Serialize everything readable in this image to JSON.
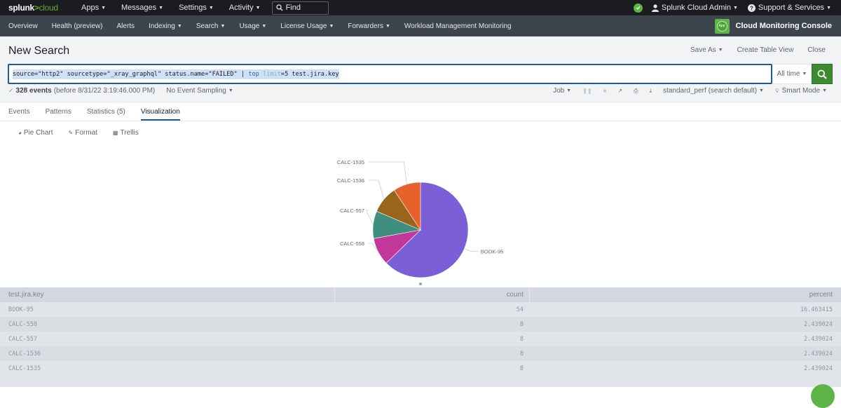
{
  "topbar": {
    "logo_splunk": "splunk",
    "logo_gt": ">",
    "logo_cloud": "cloud",
    "menus": [
      "Apps",
      "Messages",
      "Settings",
      "Activity"
    ],
    "find_placeholder": "Find",
    "user": "Splunk Cloud Admin",
    "support": "Support & Services"
  },
  "appbar": {
    "items": [
      {
        "label": "Overview",
        "dropdown": false
      },
      {
        "label": "Health (preview)",
        "dropdown": false
      },
      {
        "label": "Alerts",
        "dropdown": false
      },
      {
        "label": "Indexing",
        "dropdown": true
      },
      {
        "label": "Search",
        "dropdown": true
      },
      {
        "label": "Usage",
        "dropdown": true
      },
      {
        "label": "License Usage",
        "dropdown": true
      },
      {
        "label": "Forwarders",
        "dropdown": true
      },
      {
        "label": "Workload Management Monitoring",
        "dropdown": false
      }
    ],
    "app_icon_label": "App",
    "app_title": "Cloud Monitoring Console"
  },
  "search": {
    "title": "New Search",
    "actions": {
      "save_as": "Save As",
      "create_table_view": "Create Table View",
      "close": "Close"
    },
    "query_parts": {
      "p1": "source=\"http2\"  sourcetype=\"_xray_graphql\" status.name=\"FAILED\" | ",
      "top": "top",
      "limit": " limit",
      "p2": "=5 test.jira.key"
    },
    "time_range": "All time",
    "events_count": "328 events",
    "events_before": "(before 8/31/22 3:19:46.000 PM)",
    "sampling": "No Event Sampling",
    "job": "Job",
    "perf": "standard_perf (search default)",
    "mode": "Smart Mode"
  },
  "tabs": [
    {
      "label": "Events",
      "active": false
    },
    {
      "label": "Patterns",
      "active": false
    },
    {
      "label": "Statistics (5)",
      "active": false
    },
    {
      "label": "Visualization",
      "active": true
    }
  ],
  "viz_toolbar": {
    "chart_type": "Pie Chart",
    "format": "Format",
    "trellis": "Trellis"
  },
  "chart_data": {
    "type": "pie",
    "title": "",
    "labels": [
      "BOOK-95",
      "CALC-558",
      "CALC-557",
      "CALC-1536",
      "CALC-1535"
    ],
    "values": [
      54,
      8,
      8,
      8,
      8
    ],
    "colors": [
      "#7b5fd6",
      "#c2389a",
      "#3f8f80",
      "#99651c",
      "#e5622d"
    ]
  },
  "results_table": {
    "columns": [
      "test.jira.key",
      "count",
      "percent"
    ],
    "rows": [
      [
        "BOOK-95",
        "54",
        "16.463415"
      ],
      [
        "CALC-558",
        "8",
        "2.439024"
      ],
      [
        "CALC-557",
        "8",
        "2.439024"
      ],
      [
        "CALC-1536",
        "8",
        "2.439024"
      ],
      [
        "CALC-1535",
        "8",
        "2.439024"
      ]
    ]
  }
}
